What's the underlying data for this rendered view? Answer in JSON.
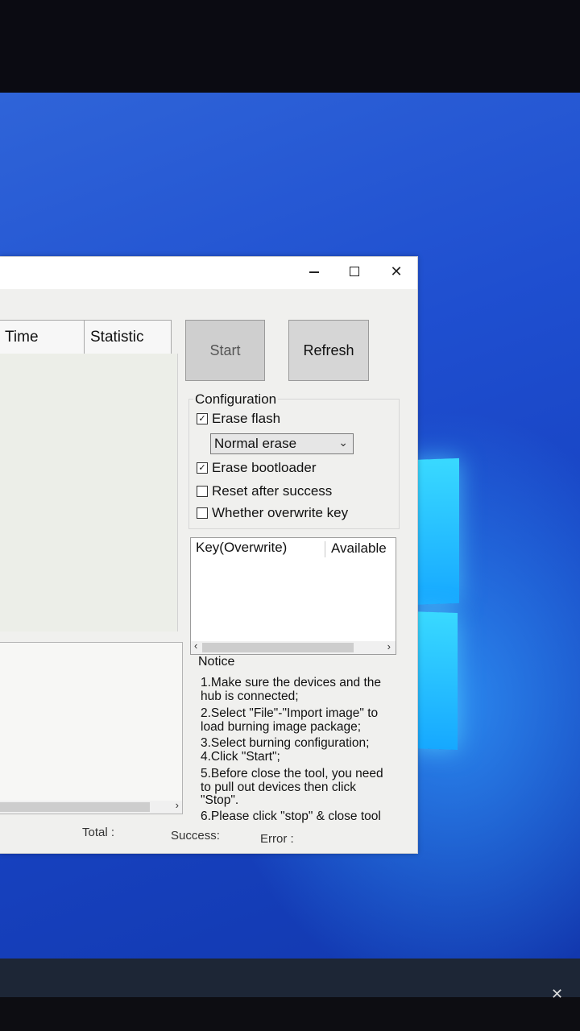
{
  "window": {
    "controls": {
      "minimize": "—",
      "maximize": "☐",
      "close": "✕"
    }
  },
  "device_grid": {
    "columns": [
      "Time",
      "Statistic"
    ]
  },
  "buttons": {
    "start": "Start",
    "refresh": "Refresh"
  },
  "configuration": {
    "title": "Configuration",
    "erase_flash": {
      "label": "Erase flash",
      "checked": true
    },
    "erase_mode": {
      "selected": "Normal erase"
    },
    "erase_bootloader": {
      "label": "Erase bootloader",
      "checked": true
    },
    "reset_after_success": {
      "label": "Reset after success",
      "checked": false
    },
    "overwrite_key": {
      "label": "Whether overwrite key",
      "checked": false
    }
  },
  "key_table": {
    "columns": [
      "Key(Overwrite)",
      "Available"
    ]
  },
  "notice": {
    "title": "Notice",
    "lines": [
      "1.Make sure the devices and the",
      "hub is connected;",
      "2.Select \"File\"-\"Import image\" to",
      "load burning image package;",
      "3.Select burning configuration;",
      "4.Click \"Start\";",
      "5.Before close the tool, you need",
      "to pull out devices then click",
      "\"Stop\".",
      "6.Please click \"stop\" & close tool"
    ]
  },
  "status": {
    "total": "Total :",
    "success": "Success:",
    "error": "Error :"
  },
  "colors": {
    "desktop_blue": "#1f4fd0",
    "window_bg": "#f0f0ee",
    "logo_cyan": "#39d9ff"
  }
}
